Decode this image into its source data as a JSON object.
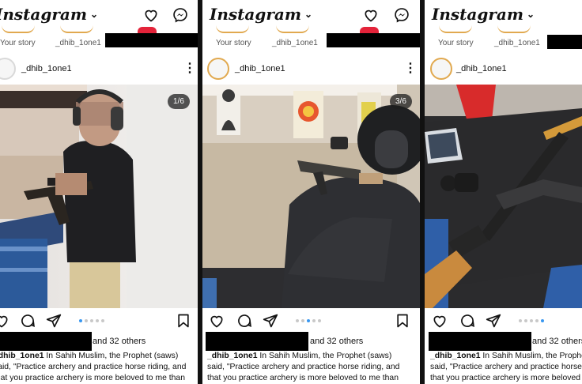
{
  "app": {
    "brand": "Instagram",
    "brand_chevron": "⌄",
    "your_story_label": "Your story",
    "story_user": "_dhib_1one1",
    "username": "_dhib_1one1",
    "more_glyph": "⋮",
    "likes_suffix": "and 32 others",
    "caption_lines": [
      "In Sahih Muslim, the Prophet (saws)",
      "said, \"Practice archery and practice horse riding, and",
      "that you practice archery is more beloved to me than"
    ]
  },
  "posts": [
    {
      "counter": "1/6",
      "active_dot": 0
    },
    {
      "counter": "3/6",
      "active_dot": 2
    },
    {
      "counter": "",
      "active_dot": 4
    }
  ],
  "colors": {
    "carousel_active": "#3897f0",
    "notification": "#e4233a",
    "redaction": "#000000"
  },
  "icons": [
    "heart-icon",
    "messenger-icon",
    "comment-icon",
    "share-icon",
    "bookmark-icon",
    "more-icon"
  ]
}
